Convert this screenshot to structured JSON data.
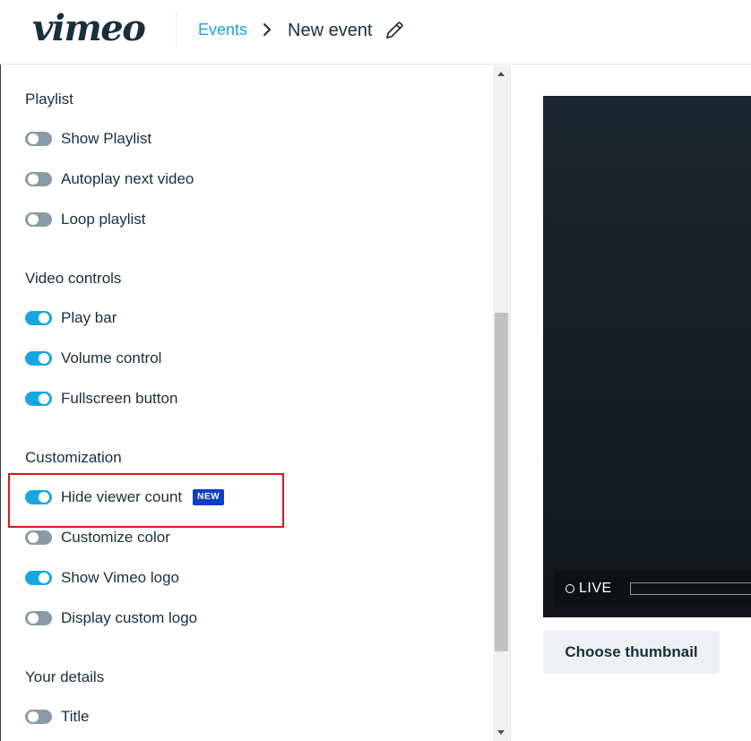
{
  "header": {
    "logo": "vimeo",
    "breadcrumb_parent": "Events",
    "breadcrumb_current": "New event"
  },
  "sections": [
    {
      "title": "Playlist",
      "items": [
        {
          "label": "Show Playlist",
          "on": false
        },
        {
          "label": "Autoplay next video",
          "on": false
        },
        {
          "label": "Loop playlist",
          "on": false
        }
      ]
    },
    {
      "title": "Video controls",
      "items": [
        {
          "label": "Play bar",
          "on": true
        },
        {
          "label": "Volume control",
          "on": true
        },
        {
          "label": "Fullscreen button",
          "on": true
        }
      ]
    },
    {
      "title": "Customization",
      "items": [
        {
          "label": "Hide viewer count",
          "on": true,
          "badge": "NEW"
        },
        {
          "label": "Customize color",
          "on": false
        },
        {
          "label": "Show Vimeo logo",
          "on": true
        },
        {
          "label": "Display custom logo",
          "on": false
        }
      ]
    },
    {
      "title": "Your details",
      "items": [
        {
          "label": "Title",
          "on": false
        }
      ]
    }
  ],
  "preview": {
    "live_label": "LIVE",
    "thumbnail_button": "Choose thumbnail"
  },
  "colors": {
    "accent": "#17a6e0",
    "toggle_off": "#8a9aa4",
    "badge": "#0d3fcb",
    "highlight": "#e0131f"
  },
  "icons": {
    "breadcrumb_separator": "chevron-right-icon",
    "edit": "pencil-icon"
  }
}
